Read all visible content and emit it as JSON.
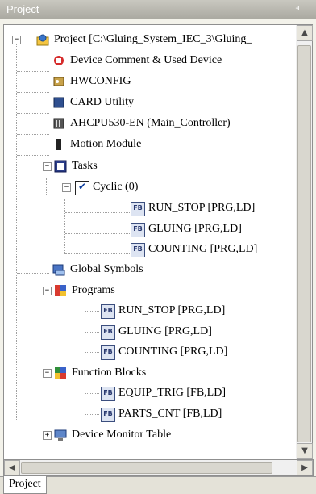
{
  "panel": {
    "title": "Project",
    "pin_glyph": "ⅎ"
  },
  "tree": {
    "root": "Project [C:\\Gluing_System_IEC_3\\Gluing_",
    "items": {
      "device_comment": "Device Comment & Used Device",
      "hwconfig": "HWCONFIG",
      "card_utility": "CARD Utility",
      "cpu": "AHCPU530-EN  (Main_Controller)",
      "motion": "Motion Module",
      "tasks": "Tasks",
      "cyclic": "Cyclic (0)",
      "task_run_stop": "RUN_STOP [PRG,LD]",
      "task_gluing": "GLUING [PRG,LD]",
      "task_counting": "COUNTING [PRG,LD]",
      "global_symbols": "Global Symbols",
      "programs": "Programs",
      "prog_run_stop": "RUN_STOP [PRG,LD]",
      "prog_gluing": "GLUING [PRG,LD]",
      "prog_counting": "COUNTING [PRG,LD]",
      "function_blocks": "Function Blocks",
      "fb_equip_trig": "EQUIP_TRIG [FB,LD]",
      "fb_parts_cnt": "PARTS_CNT [FB,LD]",
      "device_monitor": "Device Monitor Table"
    }
  },
  "tabs": {
    "project": "Project"
  },
  "icons": {
    "expand": "⊟",
    "collapse": "⊞",
    "check": "✔",
    "fb": "FB"
  }
}
